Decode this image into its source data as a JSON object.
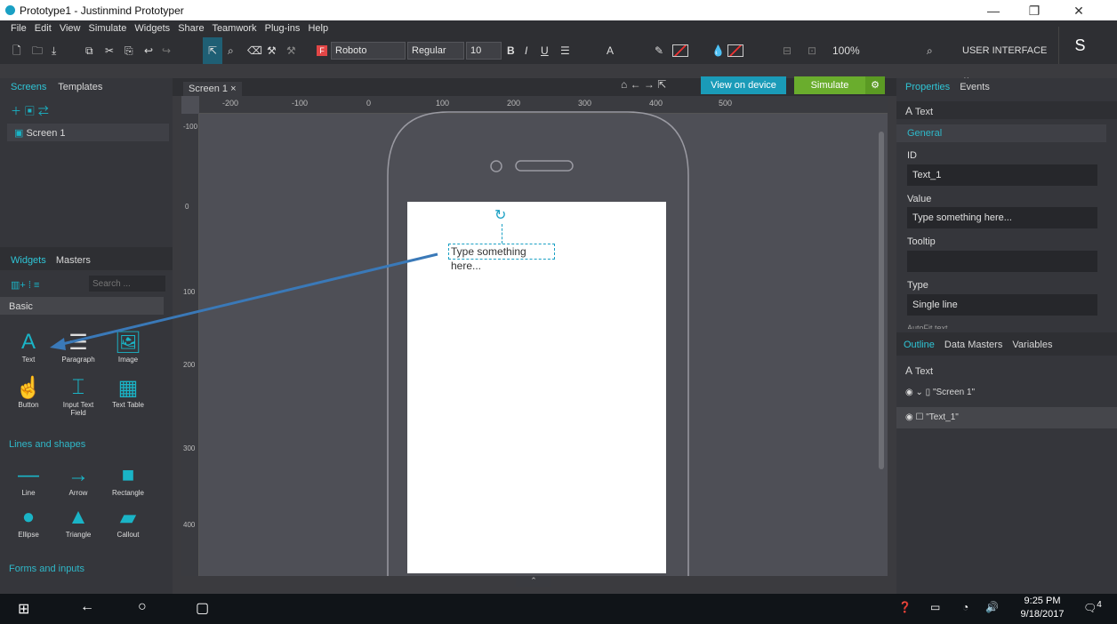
{
  "window": {
    "title": "Prototype1 - Justinmind Prototyper",
    "minimize": "—",
    "restore": "❐",
    "close": "✕"
  },
  "menu": [
    "File",
    "Edit",
    "View",
    "Simulate",
    "Widgets",
    "Share",
    "Teamwork",
    "Plug-ins",
    "Help"
  ],
  "toolbar": {
    "font": "Roboto",
    "style": "Regular",
    "size": "10",
    "bold": "B",
    "italic": "I",
    "underline": "U",
    "zoom": "100%",
    "font_color_label": "A"
  },
  "header_right": {
    "mode": "USER INTERFACE",
    "avatar": "S"
  },
  "left": {
    "tabs": [
      "Screens",
      "Templates"
    ],
    "screens": [
      "Screen 1"
    ],
    "widget_tabs": [
      "Widgets",
      "Masters"
    ],
    "search_placeholder": "Search ...",
    "category": "Basic",
    "widgets": [
      "Text",
      "Paragraph",
      "Image",
      "Button",
      "Input Text Field",
      "Text Table"
    ],
    "section_lines": "Lines and shapes",
    "shapes": [
      "Line",
      "Arrow",
      "Rectangle",
      "Ellipse",
      "Triangle",
      "Callout"
    ],
    "section_forms": "Forms and inputs"
  },
  "canvas": {
    "tab": "Screen 1",
    "view_on_device": "View on device",
    "simulate": "Simulate",
    "text_widget": "Type something here...",
    "ruler_h": [
      "-200",
      "-100",
      "0",
      "100",
      "200",
      "300",
      "400",
      "500"
    ],
    "ruler_v": [
      "-100",
      "0",
      "100",
      "200",
      "300",
      "400"
    ]
  },
  "right": {
    "tabs": [
      "Properties",
      "Events"
    ],
    "selected": "Text",
    "group": "General",
    "id_label": "ID",
    "id_value": "Text_1",
    "value_label": "Value",
    "value_value": "Type something here...",
    "tooltip_label": "Tooltip",
    "tooltip_value": "",
    "type_label": "Type",
    "type_value": "Single line",
    "autofit": "AutoFit text",
    "outline_tabs": [
      "Outline",
      "Data Masters",
      "Variables"
    ],
    "outline_selected": "Text",
    "tree": [
      "\"Screen 1\"",
      "\"Text_1\""
    ]
  },
  "taskbar": {
    "time": "9:25 PM",
    "date": "9/18/2017",
    "notifications": "4"
  }
}
